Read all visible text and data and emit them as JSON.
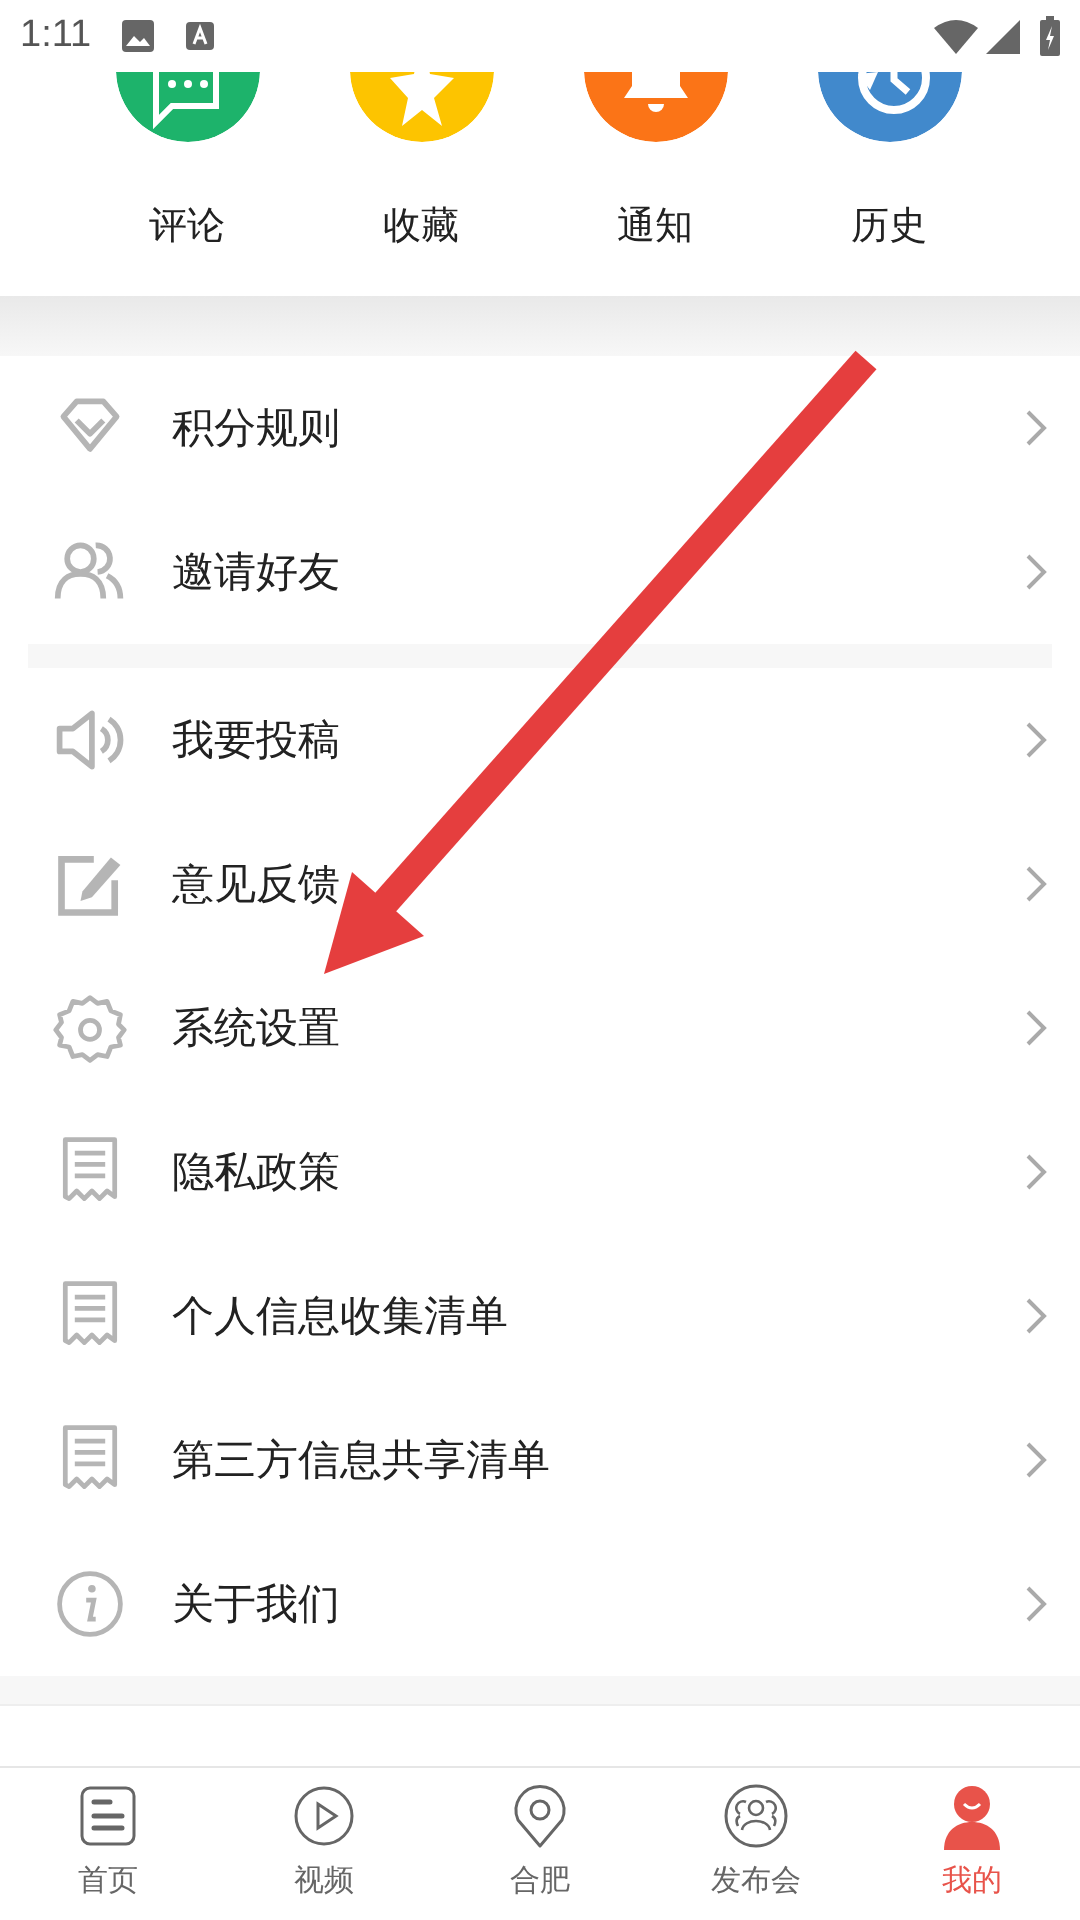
{
  "status_bar": {
    "time": "1:11"
  },
  "shortcuts": [
    {
      "label": "评论",
      "color": "#1db36b"
    },
    {
      "label": "收藏",
      "color": "#fdc400"
    },
    {
      "label": "通知",
      "color": "#fb7417"
    },
    {
      "label": "历史",
      "color": "#4189cc"
    }
  ],
  "menu_groups": [
    {
      "items": [
        {
          "label": "积分规则"
        },
        {
          "label": "邀请好友"
        }
      ]
    },
    {
      "items": [
        {
          "label": "我要投稿"
        },
        {
          "label": "意见反馈"
        },
        {
          "label": "系统设置"
        },
        {
          "label": "隐私政策"
        },
        {
          "label": "个人信息收集清单"
        },
        {
          "label": "第三方信息共享清单"
        },
        {
          "label": "关于我们"
        }
      ]
    }
  ],
  "tabs": [
    {
      "label": "首页",
      "selected": false
    },
    {
      "label": "视频",
      "selected": false
    },
    {
      "label": "合肥",
      "selected": false
    },
    {
      "label": "发布会",
      "selected": false
    },
    {
      "label": "我的",
      "selected": true
    }
  ]
}
